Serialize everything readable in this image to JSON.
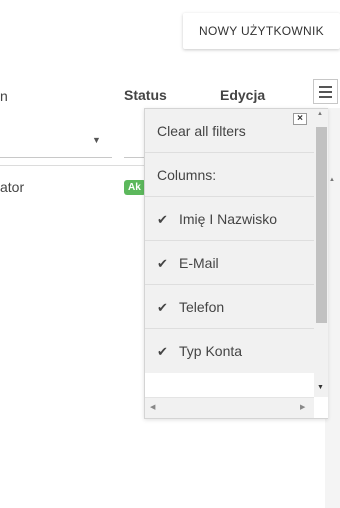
{
  "toolbar": {
    "new_user_label": "NOWY UŻYTKOWNIK"
  },
  "table": {
    "headers": {
      "partial": "n",
      "status": "Status",
      "edycja": "Edycja"
    },
    "row": {
      "partial_text": "ator",
      "status_badge": "Ak"
    }
  },
  "column_menu": {
    "clear_filters": "Clear all filters",
    "columns_label": "Columns:",
    "columns": [
      {
        "label": "Imię I Nazwisko",
        "checked": true
      },
      {
        "label": "E-Mail",
        "checked": true
      },
      {
        "label": "Telefon",
        "checked": true
      },
      {
        "label": "Typ Konta",
        "checked": true
      }
    ]
  },
  "icons": {
    "check": "✔",
    "close": "×",
    "caret": "▼",
    "menu": "hamburger-icon"
  },
  "colors": {
    "badge_green": "#5cb85c"
  }
}
